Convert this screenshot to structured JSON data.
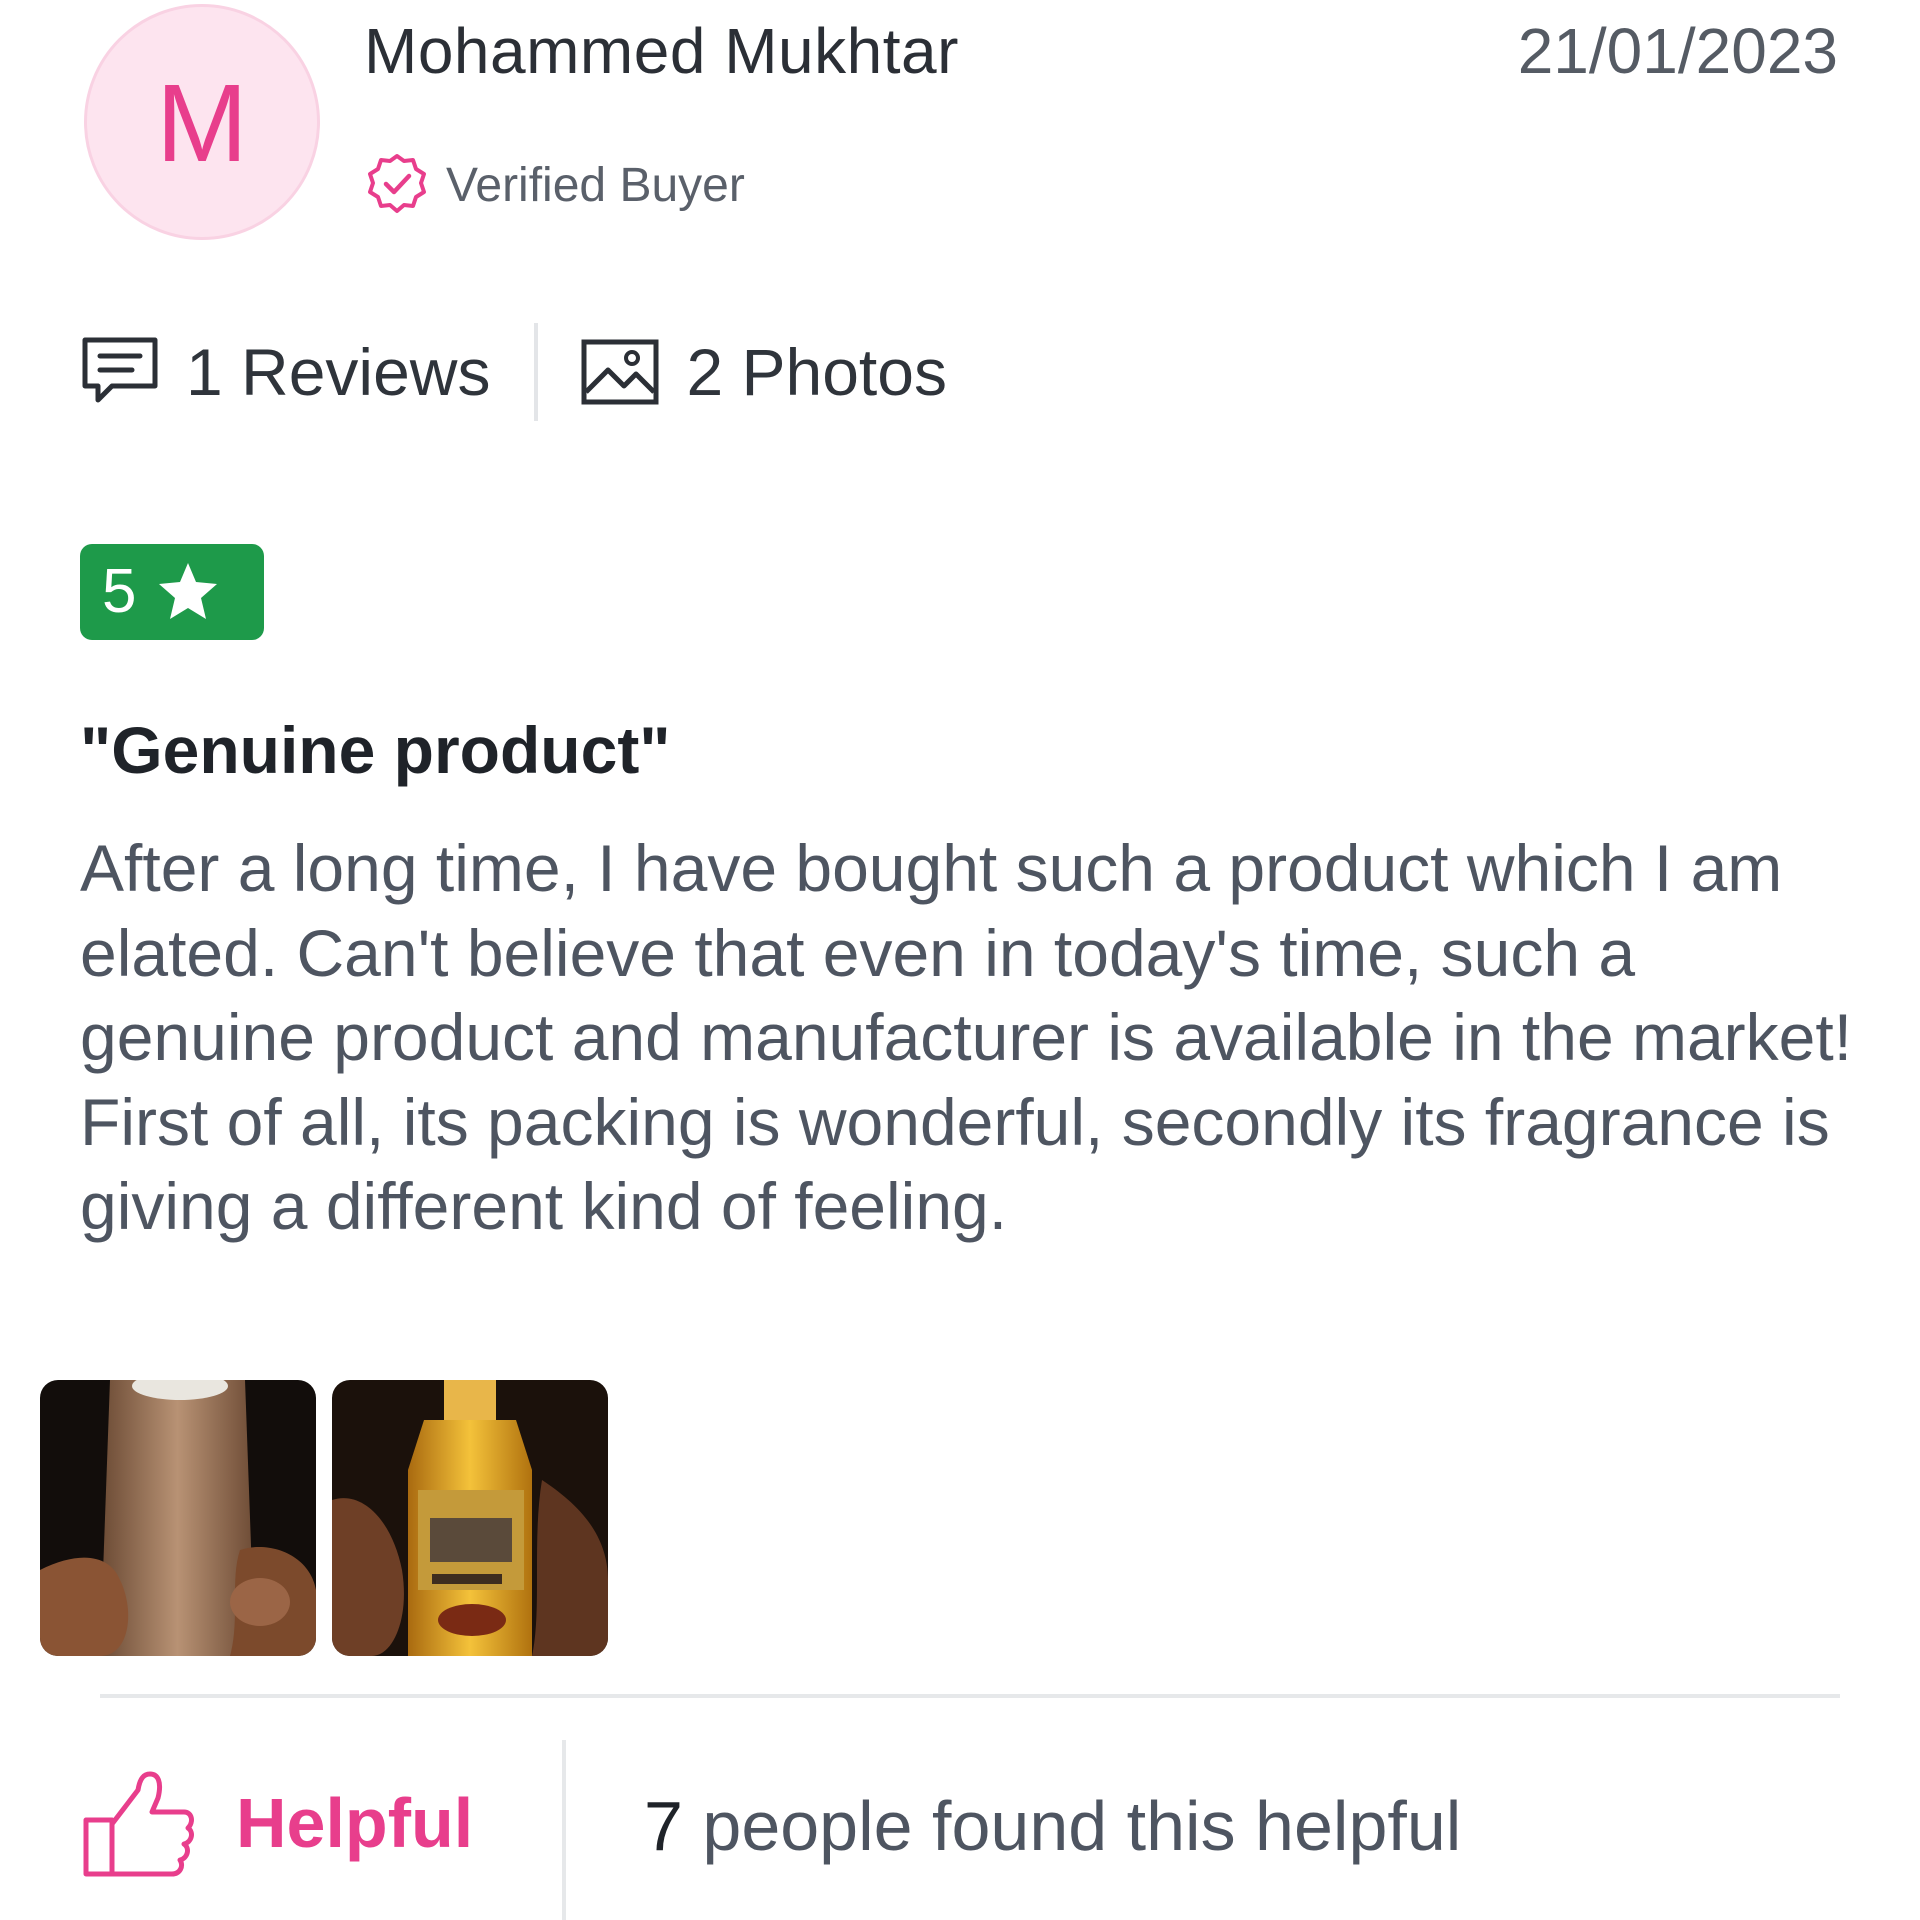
{
  "reviewer": {
    "initial": "M",
    "name": "Mohammed Mukhtar",
    "badge": "Verified Buyer"
  },
  "review": {
    "date": "21/01/2023",
    "rating": "5",
    "title": "\"Genuine product\"",
    "body": "After a long time, I have bought such a product which I am elated. Can't believe that even in today's time, such a genuine product and manufacturer is available in the market! First of all, its packing is wonderful, secondly its fragrance is giving a different kind of feeling."
  },
  "stats": {
    "reviews_label": "1 Reviews",
    "photos_label": "2 Photos"
  },
  "photos": [
    {
      "icon": "product-photo-wrapped-bottle"
    },
    {
      "icon": "product-photo-oil-bottle"
    }
  ],
  "footer": {
    "helpful_label": "Helpful",
    "helpful_count": "7",
    "helpful_suffix": " people found this helpful"
  },
  "colors": {
    "accent": "#e83e8c",
    "rating_green": "#1e9a4a",
    "avatar_bg": "#fde4ef"
  }
}
